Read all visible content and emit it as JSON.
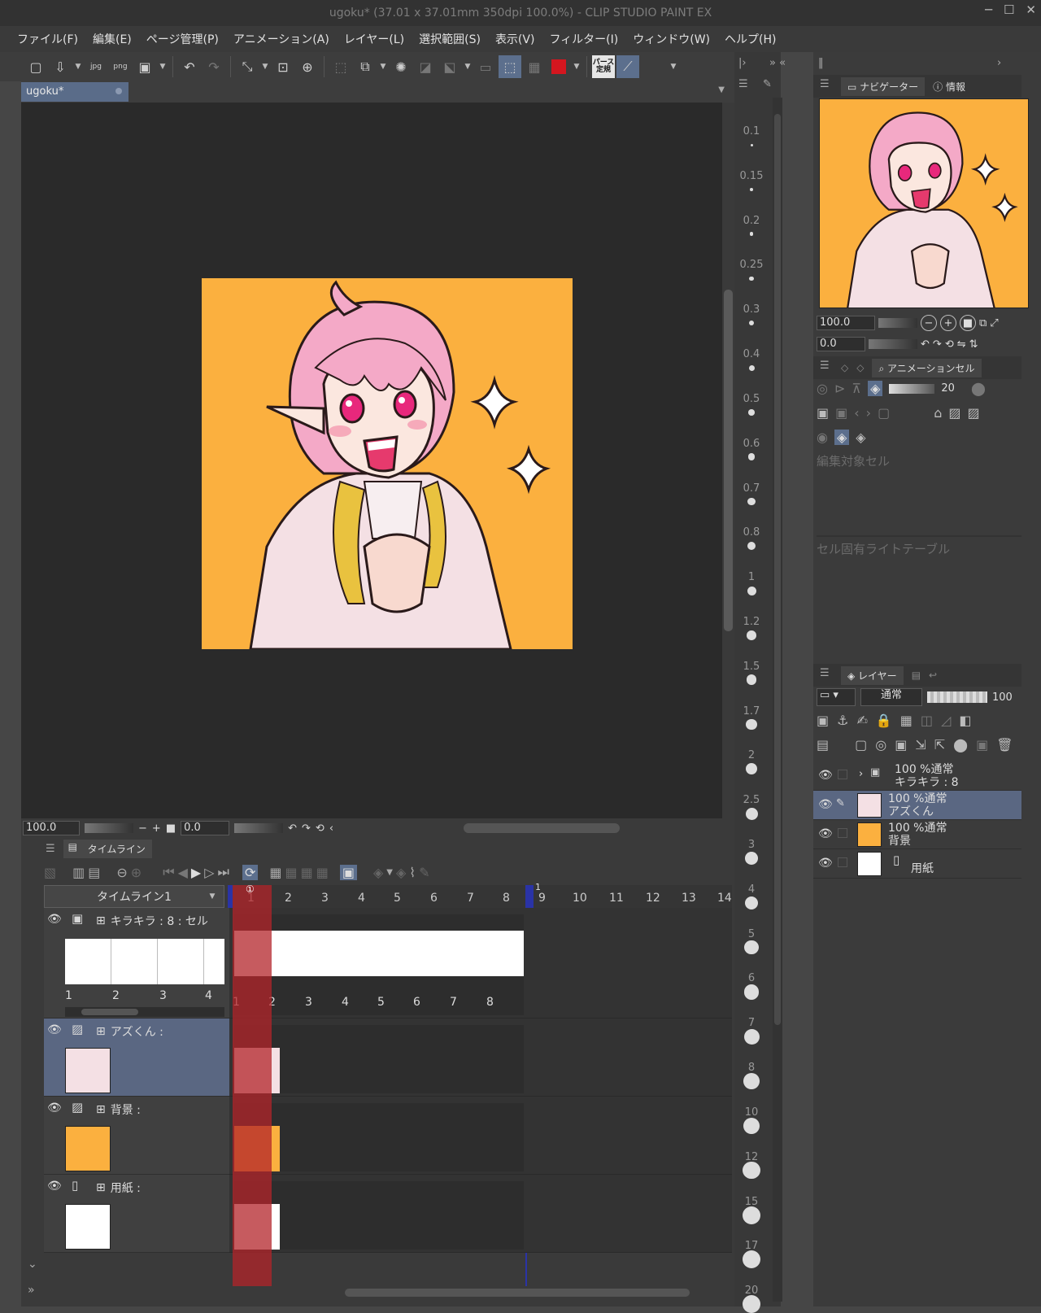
{
  "app": {
    "title": "ugoku* (37.01 x 37.01mm 350dpi 100.0%)  - CLIP STUDIO PAINT EX"
  },
  "menu": [
    "ファイル(F)",
    "編集(E)",
    "ページ管理(P)",
    "アニメーション(A)",
    "レイヤー(L)",
    "選択範囲(S)",
    "表示(V)",
    "フィルター(I)",
    "ウィンドウ(W)",
    "ヘルプ(H)"
  ],
  "toolbar": {
    "items": [
      "new-icon",
      "import-icon",
      "export-jpg-icon",
      "export-png-icon",
      "export-image-icon",
      "undo-icon",
      "redo-icon",
      "transform-icon",
      "fit-icon",
      "zoom-icon",
      "deselect-icon",
      "crop-icon",
      "select-launcher-icon",
      "invert-icon",
      "expand-icon",
      "select-mode-icon",
      "ruler-snap-icon",
      "grid-icon",
      "color-swatch-icon",
      "perspective-icon",
      "snap-icon"
    ],
    "perspective_label": "パース定規",
    "swatch_color": "#d4161f",
    "accent": "#5c6f8d"
  },
  "document": {
    "tab_label": "ugoku*"
  },
  "canvas_status": {
    "zoom": "100.0",
    "rotation": "0.0",
    "minus": "−",
    "plus": "+"
  },
  "timeline": {
    "tab_label": "タイムライン",
    "selector": "タイムライン1",
    "ruler_numbers": [
      "1",
      "2",
      "3",
      "4",
      "5",
      "6",
      "7",
      "8",
      "9",
      "10",
      "11",
      "12",
      "13",
      "14"
    ],
    "playhead_marker": "①",
    "end_marker_label": "1",
    "tracks": [
      {
        "name": "キラキラ : 8 : セル",
        "cel_numbers": [
          "1",
          "2",
          "3",
          "4"
        ],
        "frame_cels": [
          "1",
          "2",
          "3",
          "4",
          "5",
          "6",
          "7",
          "8"
        ]
      },
      {
        "name": "アズくん :"
      },
      {
        "name": "背景 :"
      },
      {
        "name": "用紙 :"
      }
    ]
  },
  "zoom_strip": {
    "labels": [
      "0.1",
      "0.15",
      "0.2",
      "0.25",
      "0.3",
      "0.4",
      "0.5",
      "0.6",
      "0.7",
      "0.8",
      "1",
      "1.2",
      "1.5",
      "1.7",
      "2",
      "2.5",
      "3",
      "4",
      "5",
      "6",
      "7",
      "8",
      "10",
      "12",
      "15",
      "17",
      "20"
    ]
  },
  "navigator": {
    "tab_navigator": "ナビゲーター",
    "tab_info": "情報",
    "zoom": "100.0",
    "angle": "0.0"
  },
  "animation_cel": {
    "tab_label": "アニメーションセル",
    "onion_count": "20",
    "edit_target_label": "編集対象セル",
    "light_table_label": "セル固有ライトテーブル"
  },
  "layers": {
    "tab_label": "レイヤー",
    "blend_mode": "通常",
    "opacity": "100",
    "items": [
      {
        "line1": "100 %通常",
        "line2": "キラキラ : 8"
      },
      {
        "line1": "100 %通常",
        "line2": "アズくん"
      },
      {
        "line1": "100 %通常",
        "line2": "背景"
      },
      {
        "line1": "",
        "line2": "用紙"
      }
    ]
  },
  "colors": {
    "background_fill": "#fbb03f",
    "playhead": "#b3242a",
    "range_marker": "#2a33a6",
    "selected_row": "#5a6782"
  }
}
